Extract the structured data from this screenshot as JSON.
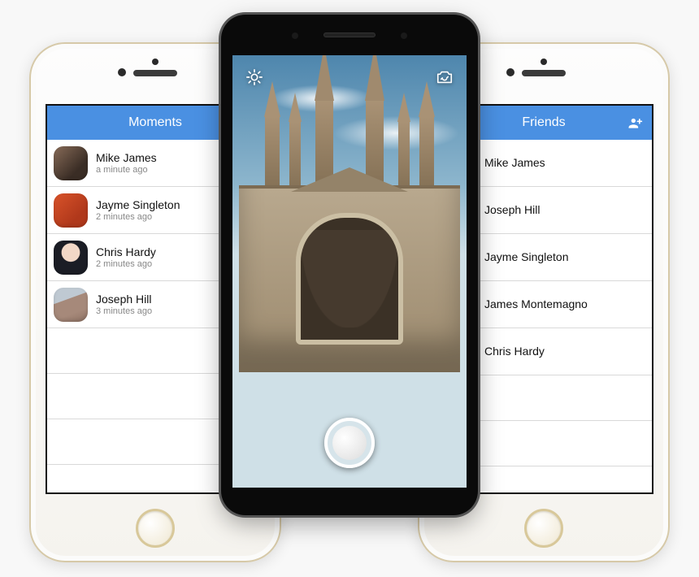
{
  "colors": {
    "navbar": "#4a90e2"
  },
  "camera": {
    "flash_icon": "sun-icon",
    "switch_icon": "camera-switch-icon",
    "shutter_label": "Shutter"
  },
  "moments": {
    "title": "Moments",
    "items": [
      {
        "name": "Mike James",
        "subtitle": "a minute ago",
        "avatar": "av-mike"
      },
      {
        "name": "Jayme Singleton",
        "subtitle": "2 minutes ago",
        "avatar": "av-jayme"
      },
      {
        "name": "Chris Hardy",
        "subtitle": "2 minutes ago",
        "avatar": "av-chris"
      },
      {
        "name": "Joseph Hill",
        "subtitle": "3 minutes ago",
        "avatar": "av-joseph"
      }
    ]
  },
  "friends": {
    "title": "Friends",
    "left_icon": "group-icon",
    "right_icon": "add-friend-icon",
    "items": [
      {
        "name": "Mike James",
        "avatar": "av-mike"
      },
      {
        "name": "Joseph Hill",
        "avatar": "av-joseph"
      },
      {
        "name": "Jayme Singleton",
        "avatar": "av-jayme"
      },
      {
        "name": "James Montemagno",
        "avatar": "av-james"
      },
      {
        "name": "Chris Hardy",
        "avatar": "av-chris"
      }
    ]
  }
}
